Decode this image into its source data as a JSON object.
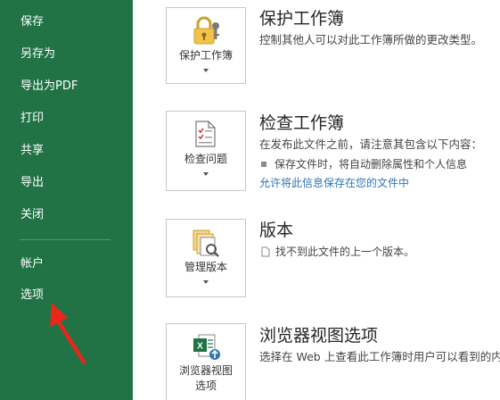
{
  "sidebar": {
    "items": [
      {
        "label": "保存"
      },
      {
        "label": "另存为"
      },
      {
        "label": "导出为PDF"
      },
      {
        "label": "打印"
      },
      {
        "label": "共享"
      },
      {
        "label": "导出"
      },
      {
        "label": "关闭"
      }
    ],
    "bottom_items": [
      {
        "label": "帐户"
      },
      {
        "label": "选项"
      }
    ],
    "background_color": "#217346"
  },
  "annotation": {
    "color": "#e8261c",
    "icon": "red-arrow-pointing-to-options"
  },
  "sections": [
    {
      "tile_label": "保护工作簿",
      "icon": "lock-key-icon",
      "title": "保护工作簿",
      "description": "控制其他人可以对此工作簿所做的更改类型。"
    },
    {
      "tile_label": "检查问题",
      "icon": "inspect-checklist-icon",
      "title": "检查工作簿",
      "description": "在发布此文件之前，请注意其包含以下内容：",
      "bullet": "保存文件时，将自动删除属性和个人信息",
      "link": "允许将此信息保存在您的文件中"
    },
    {
      "tile_label": "管理版本",
      "icon": "manage-versions-icon",
      "title": "版本",
      "description_row": "找不到此文件的上一个版本。"
    },
    {
      "tile_label_line1": "浏览器视图",
      "tile_label_line2": "选项",
      "icon": "excel-browser-view-icon",
      "title": "浏览器视图选项",
      "description": "选择在 Web 上查看此工作簿时用户可以看到的内容。"
    }
  ],
  "colors": {
    "link": "#2e75b6",
    "accent_green": "#217346"
  }
}
